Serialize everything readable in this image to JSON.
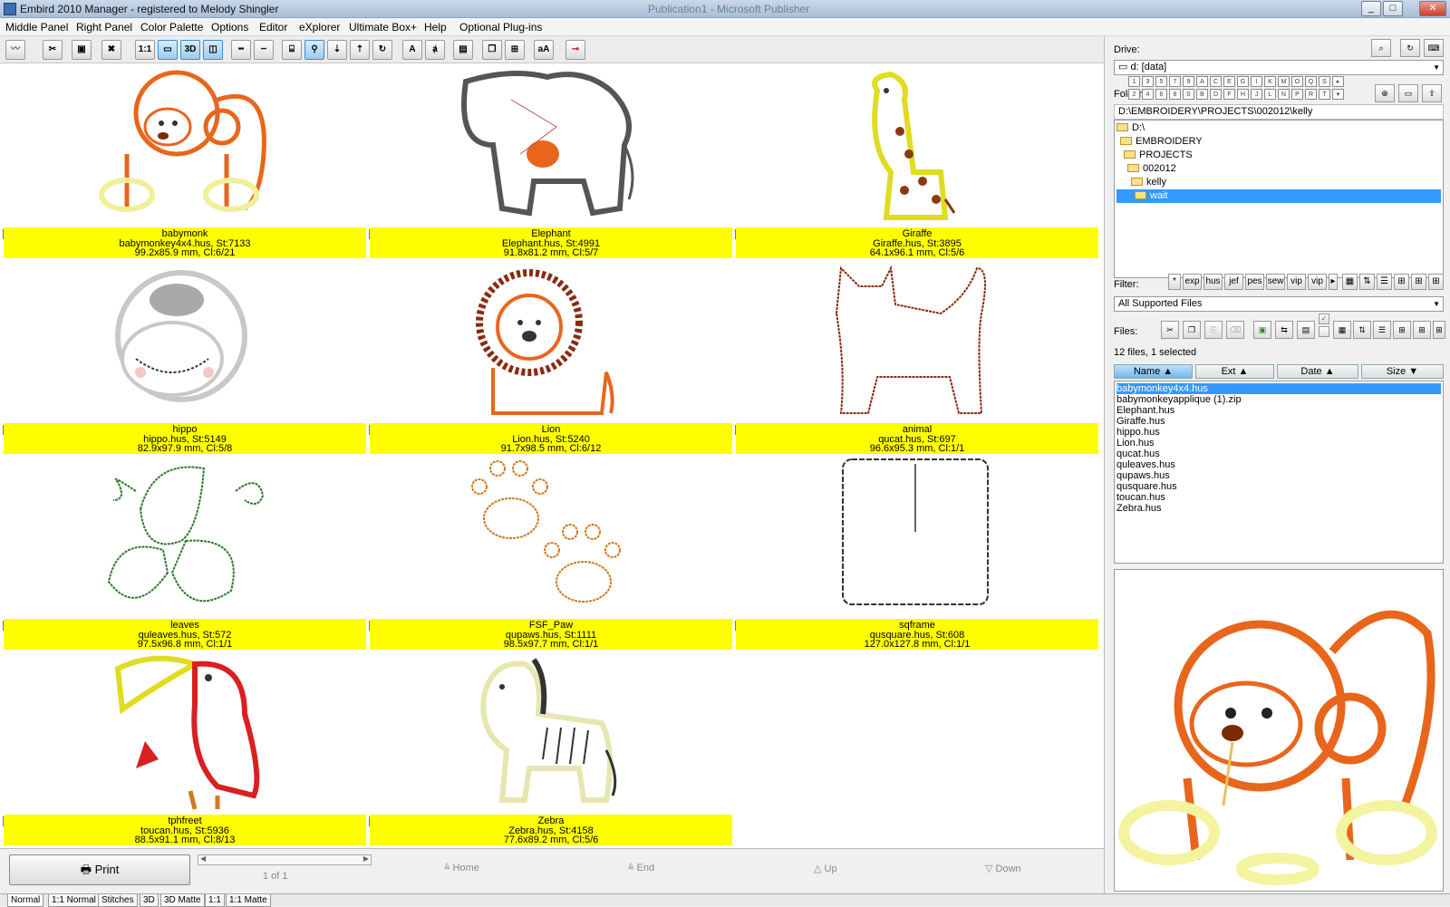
{
  "window": {
    "title": "Embird 2010 Manager - registered to Melody Shingler",
    "ghost_title": "Publication1 - Microsoft Publisher"
  },
  "menu": [
    "Middle Panel",
    "Right Panel",
    "Color Palette",
    "Options",
    "Editor",
    "eXplorer",
    "Ultimate Box+",
    "Help",
    "Optional Plug-ins"
  ],
  "toolbar": {
    "buttons": [
      "1:1",
      "3D",
      "A"
    ]
  },
  "designs": [
    {
      "name": "babymonk",
      "file": "babymonkey4x4.hus, St:7133",
      "size": "99.2x85.9 mm, Cl:6/21"
    },
    {
      "name": "Elephant",
      "file": "Elephant.hus, St:4991",
      "size": "91.8x81.2 mm, Cl:5/7"
    },
    {
      "name": "Giraffe",
      "file": "Giraffe.hus, St:3895",
      "size": "64.1x96.1 mm, Cl:5/6"
    },
    {
      "name": "hippo",
      "file": "hippo.hus, St:5149",
      "size": "82.9x97.9 mm, Cl:5/8"
    },
    {
      "name": "Lion",
      "file": "Lion.hus, St:5240",
      "size": "91.7x98.5 mm, Cl:6/12"
    },
    {
      "name": "animal",
      "file": "qucat.hus, St:697",
      "size": "96.6x95.3 mm, Cl:1/1"
    },
    {
      "name": "leaves",
      "file": "quleaves.hus, St:572",
      "size": "97.5x96.8 mm, Cl:1/1"
    },
    {
      "name": "FSF_Paw",
      "file": "qupaws.hus, St:1111",
      "size": "98.5x97.7 mm, Cl:1/1"
    },
    {
      "name": "sqframe",
      "file": "qusquare.hus, St:608",
      "size": "127.0x127.8 mm, Cl:1/1"
    },
    {
      "name": "tphfreet",
      "file": "toucan.hus, St:5936",
      "size": "88.5x91.1 mm, Cl:8/13"
    },
    {
      "name": "Zebra",
      "file": "Zebra.hus, St:4158",
      "size": "77.6x89.2 mm, Cl:5/6"
    }
  ],
  "nav": {
    "print": "Print",
    "page": "1 of 1",
    "home": "Home",
    "end": "End",
    "up": "Up",
    "down": "Down"
  },
  "tabs": [
    "Normal",
    "1:1 Normal",
    "Stitches",
    "3D",
    "3D Matte",
    "1:1",
    "1:1 Matte"
  ],
  "right": {
    "drive_label": "Drive:",
    "drive_value": "d: [data]",
    "folder_label": "Folder:",
    "folder_letters_top": [
      "1",
      "3",
      "5",
      "7",
      "9",
      "A",
      "C",
      "E",
      "G",
      "I",
      "K",
      "M",
      "O",
      "Q",
      "S"
    ],
    "folder_letters_bottom": [
      "2",
      "4",
      "6",
      "8",
      "0",
      "B",
      "D",
      "F",
      "H",
      "J",
      "L",
      "N",
      "P",
      "R",
      "T"
    ],
    "path": "D:\\EMBROIDERY\\PROJECTS\\002012\\kelly",
    "tree": [
      "D:\\",
      "EMBROIDERY",
      "PROJECTS",
      "002012",
      "kelly",
      "wait"
    ],
    "filter_label": "Filter:",
    "filters": [
      "*",
      "exp",
      "hus",
      "jef",
      "pes",
      "sew",
      "vip",
      "vip"
    ],
    "filter_value": "All Supported Files",
    "files_label": "Files:",
    "files_count": "12 files, 1 selected",
    "columns": [
      "Name ▲",
      "Ext ▲",
      "Date ▲",
      "Size ▼"
    ],
    "files": [
      "babymonkey4x4.hus",
      "babymonkeyapplique (1).zip",
      "Elephant.hus",
      "Giraffe.hus",
      "hippo.hus",
      "Lion.hus",
      "qucat.hus",
      "quleaves.hus",
      "qupaws.hus",
      "qusquare.hus",
      "toucan.hus",
      "Zebra.hus"
    ]
  },
  "colors": {
    "caption": "#ffff00",
    "selection": "#3399ff"
  }
}
